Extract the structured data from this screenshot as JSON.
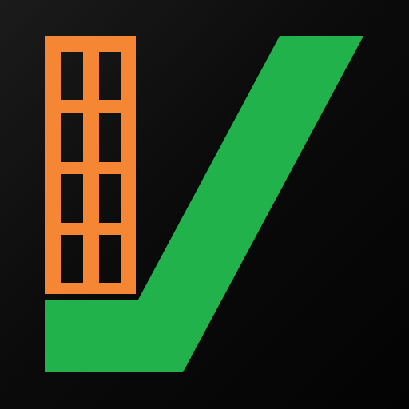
{
  "icon": {
    "name": "building-checkmark-logo",
    "colors": {
      "background": "#0b0b0b",
      "building": "#f58634",
      "checkmark": "#22b24c"
    },
    "building": {
      "window_columns": 2,
      "window_rows": 4
    }
  }
}
